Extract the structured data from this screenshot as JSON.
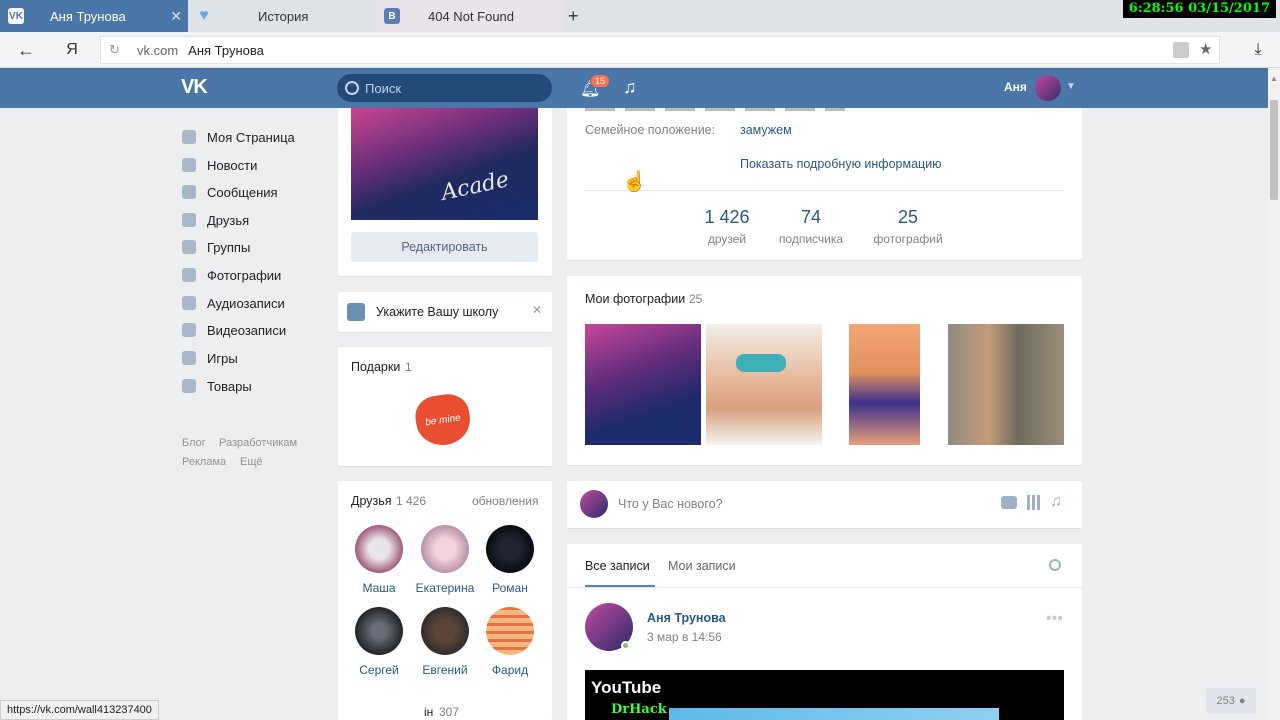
{
  "browser": {
    "tabs": [
      {
        "label": "Аня Трунова",
        "fav": "VK",
        "fav_color": "#4a76a8"
      },
      {
        "label": "История",
        "fav": "♥",
        "fav_color": "#8ab4e5"
      },
      {
        "label": "404 Not Found",
        "fav": "B",
        "fav_color": "#5a7eb5"
      }
    ],
    "new_tab": "+",
    "clock": "6:28:56  03/15/2017",
    "address": {
      "domain": "vk.com",
      "title": "Аня Трунова"
    },
    "yandex": "Я",
    "status_url": "https://vk.com/wall413237400"
  },
  "header": {
    "search_placeholder": "Поиск",
    "notifications": "15",
    "user_name": "Аня"
  },
  "menu": [
    {
      "label": "Моя Страница",
      "icon": "home-icon"
    },
    {
      "label": "Новости",
      "icon": "news-icon"
    },
    {
      "label": "Сообщения",
      "icon": "messages-icon"
    },
    {
      "label": "Друзья",
      "icon": "friends-icon"
    },
    {
      "label": "Группы",
      "icon": "groups-icon"
    },
    {
      "label": "Фотографии",
      "icon": "photos-icon"
    },
    {
      "label": "Аудиозаписи",
      "icon": "audio-icon"
    },
    {
      "label": "Видеозаписи",
      "icon": "video-icon"
    },
    {
      "label": "Игры",
      "icon": "games-icon"
    },
    {
      "label": "Товары",
      "icon": "goods-icon"
    }
  ],
  "footer_links": [
    "Блог",
    "Разработчикам",
    "Реклама",
    "Ещё"
  ],
  "profile": {
    "edit_button": "Редактировать",
    "school_prompt": "Укажите Вашу школу",
    "gifts_title": "Подарки",
    "gifts_count": "1",
    "gift_text": "be mine",
    "friends_title": "Друзья",
    "friends_count": "1 426",
    "friends_updates": "обновления",
    "friends": [
      "Маша",
      "Екатерина",
      "Роман",
      "Сергей",
      "Евгений",
      "Фарид"
    ],
    "online_count": "307",
    "online_prefix": "ін",
    "family_label": "Семейное положение:",
    "family_value": "замужем",
    "show_more": "Показать подробную информацию",
    "stats": [
      {
        "num": "1 426",
        "label": "друзей"
      },
      {
        "num": "74",
        "label": "подписчика"
      },
      {
        "num": "25",
        "label": "фотографий"
      }
    ],
    "photos_title": "Мои фотографии",
    "photos_count": "25",
    "post_placeholder": "Что у Вас нового?",
    "wall_tabs": [
      "Все записи",
      "Мои записи"
    ],
    "post_author": "Аня Трунова",
    "post_date": "3 мар в 14:56",
    "video_logo": "YouTube",
    "video_caption": "DrHack",
    "online_badge": "253"
  }
}
